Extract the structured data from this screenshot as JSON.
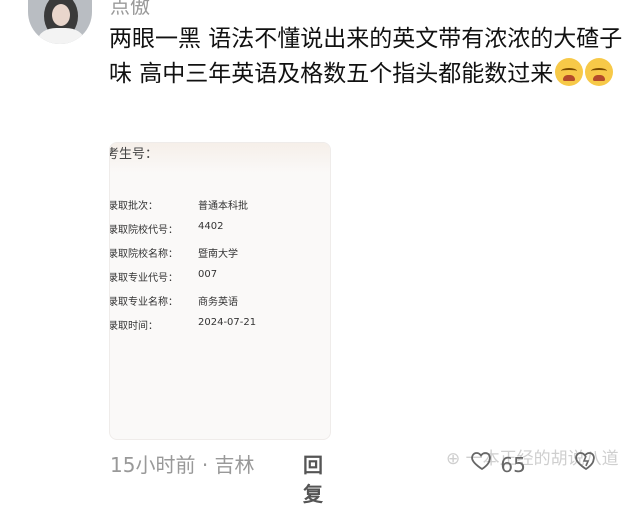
{
  "comment": {
    "username": "点傲",
    "text": "两眼一黑 语法不懂说出来的英文带有浓浓的大碴子味 高中三年英语及格数五个指头都能数过来",
    "emojis": [
      "crying-face",
      "crying-face"
    ],
    "time": "15小时前",
    "location": "吉林",
    "reply_label": "回复",
    "likes": "65"
  },
  "admission_card": {
    "exam_label": "考生号：",
    "rows": [
      {
        "key": "录取批次：",
        "value": "普通本科批"
      },
      {
        "key": "录取院校代号：",
        "value": "4402"
      },
      {
        "key": "录取院校名称：",
        "value": "暨南大学"
      },
      {
        "key": "录取专业代号：",
        "value": "007"
      },
      {
        "key": "录取专业名称：",
        "value": "商务英语"
      },
      {
        "key": "录取时间：",
        "value": "2024-07-21"
      }
    ]
  },
  "watermark": "一本正经的胡说八道"
}
